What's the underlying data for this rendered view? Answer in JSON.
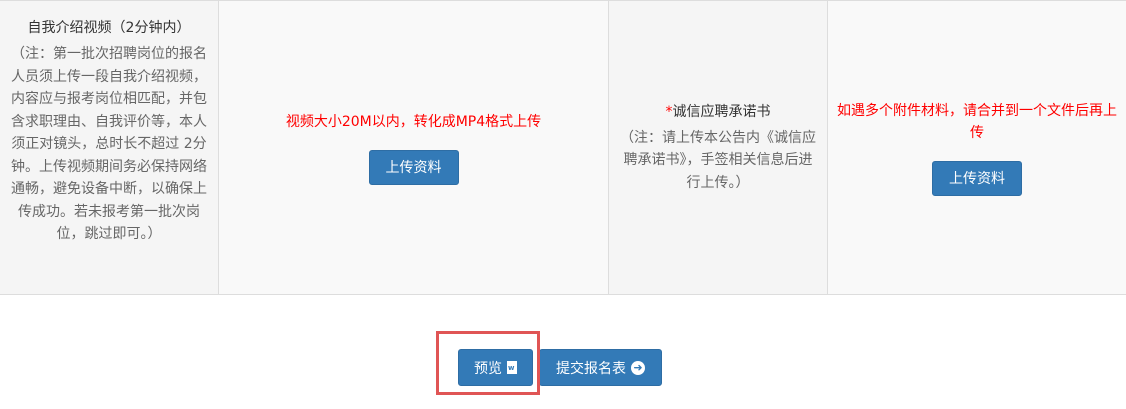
{
  "video_section": {
    "title": "自我介绍视频（2分钟内）",
    "note": "（注：第一批次招聘岗位的报名人员须上传一段自我介绍视频，内容应与报考岗位相匹配，并包含求职理由、自我评价等，本人须正对镜头，总时长不超过 2分钟。上传视频期间务必保持网络通畅，避免设备中断，以确保上传成功。若未报考第一批次岗位，跳过即可。）",
    "requirement": "视频大小20M以内，转化成MP4格式上传",
    "upload_button": "上传资料"
  },
  "pledge_section": {
    "required_mark": "*",
    "title": "诚信应聘承诺书",
    "note": "（注：请上传本公告内《诚信应聘承诺书》，手签相关信息后进行上传。）",
    "requirement": "如遇多个附件材料，请合并到一个文件后再上传",
    "upload_button": "上传资料"
  },
  "actions": {
    "preview_label": "预览",
    "preview_icon": "word-file-icon",
    "submit_label": "提交报名表",
    "submit_icon": "arrow-circle-right-icon"
  },
  "colors": {
    "primary": "#337ab7",
    "highlight": "#e05555",
    "warning_text": "#ff0000"
  }
}
